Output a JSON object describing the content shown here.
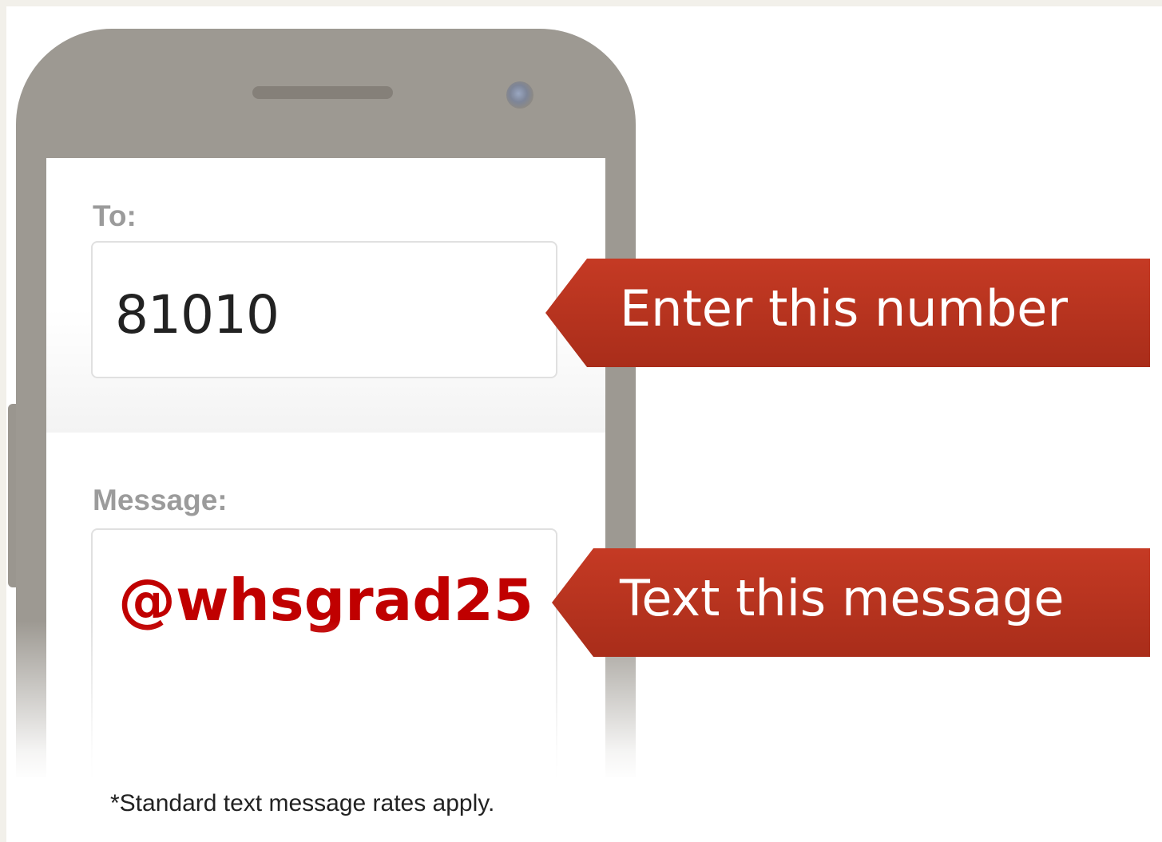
{
  "phone": {
    "to_label": "To:",
    "to_value": "81010",
    "message_label": "Message:",
    "message_value": "@whsgrad25"
  },
  "callouts": {
    "number_text": "Enter this number",
    "message_text": "Text this message"
  },
  "footnote": "*Standard text message rates apply.",
  "colors": {
    "callout": "#b8321d",
    "message_value": "#c00000",
    "phone_frame": "#9d9992"
  }
}
